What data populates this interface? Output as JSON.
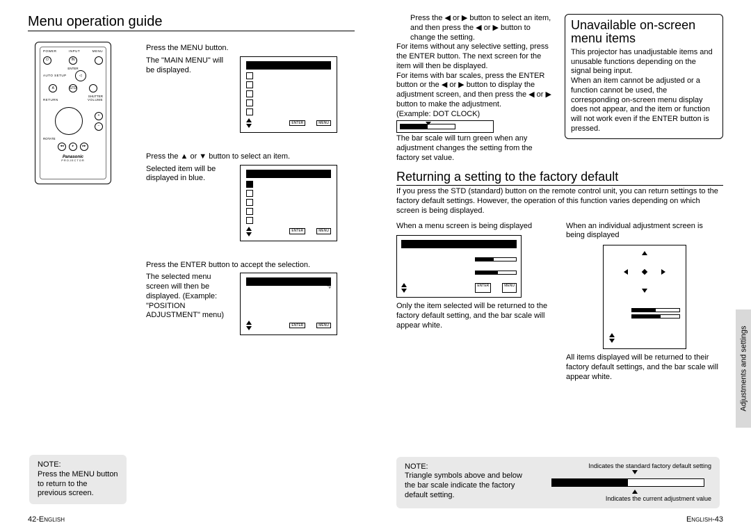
{
  "left": {
    "title": "Menu operation guide",
    "remote": {
      "top_row": [
        "POWER",
        "INPUT",
        "MENU"
      ],
      "auto_setup": "AUTO SETUP",
      "enter": "ENTER",
      "shutter": "SHUTTER",
      "return": "RETURN",
      "volume": "VOLUME",
      "rotate": "ROTATE",
      "brand": "Panasonic",
      "sub": "PROJECTOR",
      "in_btn": "IN",
      "a_btn": "A",
      "std_btn": "STD",
      "plus": "+",
      "minus": "−"
    },
    "steps": [
      {
        "intro": "Press the MENU button.",
        "text": "The \"MAIN MENU\" will be displayed.",
        "screen_footer": [
          "ENTER",
          "MENU"
        ]
      },
      {
        "intro": "Press the ▲ or ▼ button to select an item.",
        "text": "Selected item will be displayed in blue.",
        "screen_footer": [
          "ENTER",
          "MENU"
        ]
      },
      {
        "intro": "Press the ENTER button to accept the selection.",
        "text": "The selected menu screen will then be displayed. (Example: \"POSITION ADJUSTMENT\" menu)",
        "screen_title_glyph": "\"#",
        "screen_footer": [
          "ENTER",
          "MENU"
        ]
      }
    ],
    "note_label": "NOTE:",
    "note": "Press the MENU button to return to the previous screen."
  },
  "right": {
    "upper_left": {
      "p1": "Press the ◀ or ▶ button to select an item, and then press the ◀ or ▶ button to change the setting.",
      "p2": "For items without any selective setting, press the ENTER button. The next screen for the item will then be displayed.",
      "p3": "For items with bar scales, press the ENTER button or the ◀ or ▶ button to display the adjustment screen, and then press the ◀ or ▶ button to make the adjustment.",
      "example_label": "(Example: DOT CLOCK)",
      "p4": "The bar scale will turn green when any adjustment changes the setting from the factory set value."
    },
    "unavail": {
      "title": "Unavailable on-screen menu items",
      "text": "This projector has unadjustable items and unusable functions depending on the signal being input.\nWhen an item cannot be adjusted or a function cannot be used, the corresponding on-screen menu display does not appear, and the item or function will not work even if the ENTER button is pressed."
    },
    "factory": {
      "title": "Returning a setting to the factory default",
      "intro": "If you press the STD (standard) button on the remote control unit, you can return settings to the factory default settings. However, the operation of this function varies depending on which screen is being displayed.",
      "col1_head": "When a menu screen is being displayed",
      "col1_foot": "Only the item selected will be returned to the factory default setting, and the bar scale will appear white.",
      "col2_head": "When an individual adjustment screen is being displayed",
      "col2_foot": "All items displayed will be returned to their factory default settings, and the bar scale will appear white.",
      "screen_footer": [
        "ENTER",
        "MENU"
      ]
    },
    "note_label": "NOTE:",
    "note_left": "Triangle symbols above and below the bar scale indicate the factory default setting.",
    "note_right_top": "Indicates the standard factory default setting",
    "note_right_bottom": "Indicates the current adjustment value",
    "side_tab": "Adjustments and settings"
  },
  "footer": {
    "left_page": "42-",
    "left_lang": "English",
    "right_lang": "English",
    "right_page": "-43"
  }
}
